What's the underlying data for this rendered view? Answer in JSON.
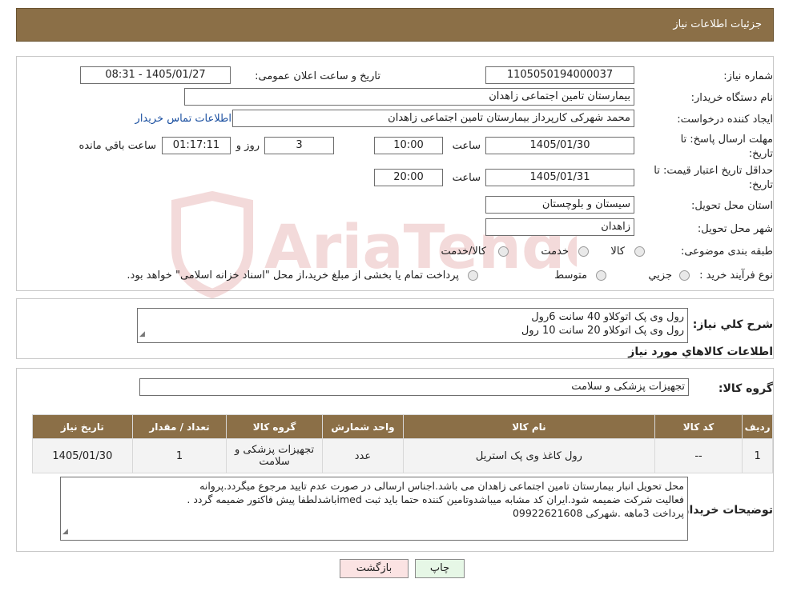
{
  "header": {
    "title": "جزئیات اطلاعات نیاز"
  },
  "form": {
    "need_number": {
      "label": "شماره نیاز:",
      "value": "1105050194000037"
    },
    "announce_datetime": {
      "label": "تاریخ و ساعت اعلان عمومی:",
      "value": "1405/01/27 - 08:31"
    },
    "buyer_org": {
      "label": "نام دستگاه خریدار:",
      "value": "بیمارستان تامین اجتماعی زاهدان"
    },
    "requester": {
      "label": "ایجاد کننده درخواست:",
      "value": "محمد شهرکی کارپرداز بیمارستان تامین اجتماعی زاهدان"
    },
    "contact_link": "اطلاعات تماس خریدار",
    "reply_deadline": {
      "label_line1": "مهلت ارسال پاسخ: تا",
      "label_line2": "تاریخ:",
      "date": "1405/01/30",
      "time_label": "ساعت",
      "time": "10:00",
      "days": "3",
      "days_label": "روز و",
      "remaining": "01:17:11",
      "remaining_label": "ساعت باقي مانده"
    },
    "price_validity": {
      "label_line1": "حداقل تاریخ اعتبار قیمت: تا",
      "label_line2": "تاریخ:",
      "date": "1405/01/31",
      "time_label": "ساعت",
      "time": "20:00"
    },
    "province": {
      "label": "استان محل تحویل:",
      "value": "سیستان و بلوچستان"
    },
    "city": {
      "label": "شهر محل تحویل:",
      "value": "زاهدان"
    },
    "category": {
      "label": "طبقه بندی موضوعی:",
      "options": [
        "کالا",
        "خدمت",
        "کالا/خدمت"
      ]
    },
    "purchase_type": {
      "label": "نوع فرآیند خرید :",
      "options": [
        "جزیي",
        "متوسط"
      ],
      "note": "پرداخت تمام یا بخشی از مبلغ خرید،از محل \"اسناد خزانه اسلامی\" خواهد بود."
    }
  },
  "summary": {
    "label": "شرح کلي نیاز:",
    "lines": [
      "رول وی پک اتوکلاو 40 سانت 6رول",
      "رول وی پک اتوکلاو 20 سانت 10 رول"
    ]
  },
  "goods_section_title": "اطلاعات کالاهاي مورد نیاز",
  "goods_group": {
    "label": "گروه کالا:",
    "value": "تجهیزات پزشکی و سلامت"
  },
  "table": {
    "headers": [
      "ردیف",
      "کد کالا",
      "نام کالا",
      "واحد شمارش",
      "گروه کالا",
      "تعداد / مقدار",
      "تاریخ نیاز"
    ],
    "rows": [
      [
        "1",
        "--",
        "رول کاغذ وی پک استریل",
        "عدد",
        "تجهیزات پزشکی و سلامت",
        "1",
        "1405/01/30"
      ]
    ]
  },
  "buyer_notes": {
    "label": "توضیحات خریدار:",
    "lines": [
      "محل تحویل انبار بیمارستان تامین اجتماعی زاهدان می باشد.اجناس ارسالی در صورت عدم تایید مرجوع میگردد.پروانه",
      "فعالیت شرکت ضمیمه شود.ایران کد مشابه میباشدوتامین کننده حتما باید ثبت imedباشدلطفا پیش فاکتور ضمیمه گردد .",
      "پرداخت 3ماهه  .شهرکی 09922621608"
    ]
  },
  "buttons": {
    "print": "چاپ",
    "back": "بازگشت"
  },
  "watermark_text": "AriaTender.neT",
  "colors": {
    "header_bg": "#8b6f47",
    "link": "#1a4fa0",
    "back_btn": "#fbe3e3",
    "print_btn": "#e6f7e6"
  }
}
